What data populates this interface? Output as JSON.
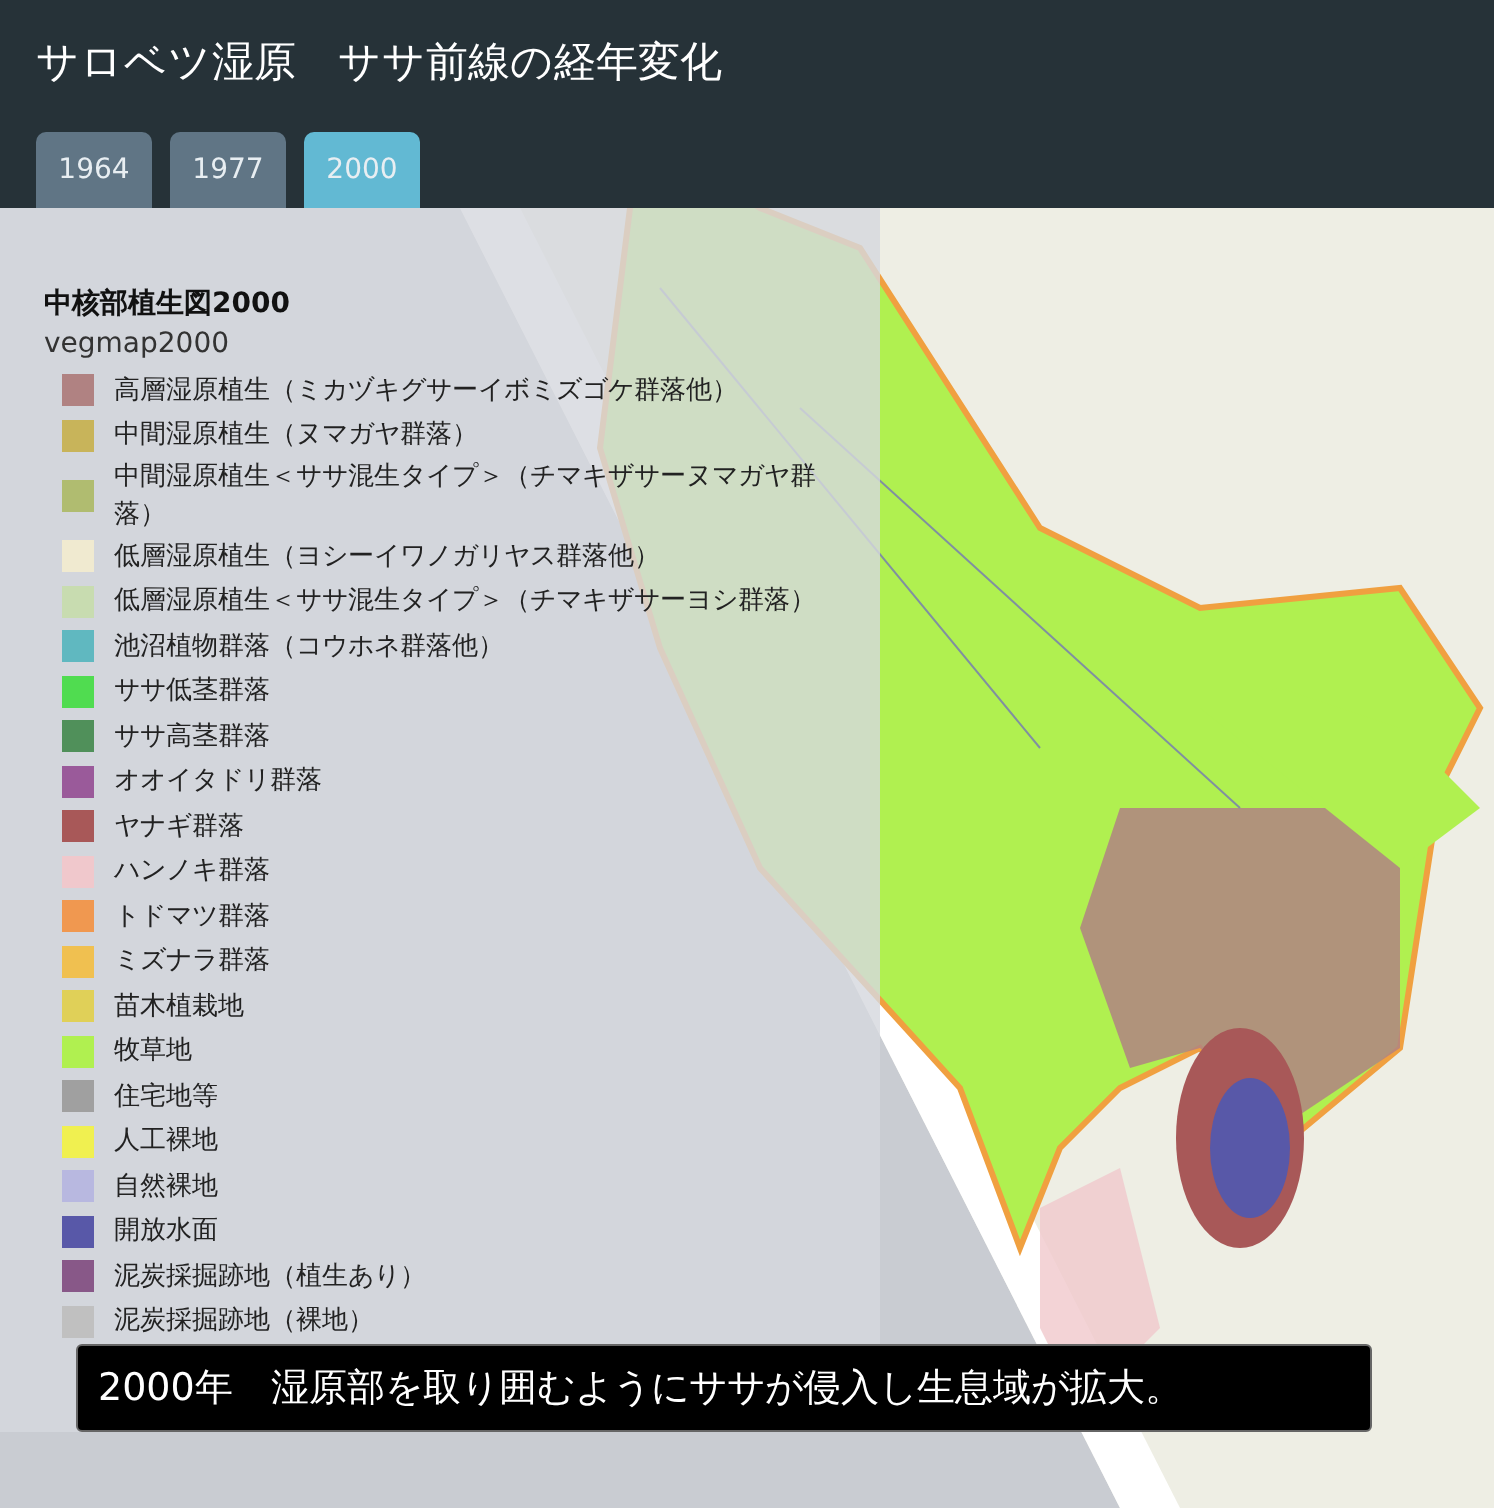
{
  "header": {
    "title": "サロベツ湿原　ササ前線の経年変化"
  },
  "tabs": [
    {
      "label": "1964",
      "selected": false
    },
    {
      "label": "1977",
      "selected": false
    },
    {
      "label": "2000",
      "selected": true
    }
  ],
  "legend": {
    "title": "中核部植生図2000",
    "layer": "vegmap2000",
    "items": [
      {
        "label": "高層湿原植生（ミカヅキグサーイボミズゴケ群落他）",
        "color": "#b08282"
      },
      {
        "label": "中間湿原植生（ヌマガヤ群落）",
        "color": "#c8b45a"
      },
      {
        "label": "中間湿原植生＜ササ混生タイプ＞（チマキザサーヌマガヤ群落）",
        "color": "#b0bc70"
      },
      {
        "label": "低層湿原植生（ヨシーイワノガリヤス群落他）",
        "color": "#f0ead0"
      },
      {
        "label": "低層湿原植生＜ササ混生タイプ＞（チマキザサーヨシ群落）",
        "color": "#c8dcb0"
      },
      {
        "label": "池沼植物群落（コウホネ群落他）",
        "color": "#60b8c0"
      },
      {
        "label": "ササ低茎群落",
        "color": "#50dc50"
      },
      {
        "label": "ササ高茎群落",
        "color": "#50905a"
      },
      {
        "label": "オオイタドリ群落",
        "color": "#9a5a9a"
      },
      {
        "label": "ヤナギ群落",
        "color": "#a85858"
      },
      {
        "label": "ハンノキ群落",
        "color": "#f0c8cc"
      },
      {
        "label": "トドマツ群落",
        "color": "#f09850"
      },
      {
        "label": "ミズナラ群落",
        "color": "#f0c050"
      },
      {
        "label": "苗木植栽地",
        "color": "#e0d058"
      },
      {
        "label": "牧草地",
        "color": "#b0f050"
      },
      {
        "label": "住宅地等",
        "color": "#a0a0a0"
      },
      {
        "label": "人工裸地",
        "color": "#f0f050"
      },
      {
        "label": "自然裸地",
        "color": "#b8b8e0"
      },
      {
        "label": "開放水面",
        "color": "#5858a8"
      },
      {
        "label": "泥炭採掘跡地（植生あり）",
        "color": "#885888"
      },
      {
        "label": "泥炭採掘跡地（裸地）",
        "color": "#c0c0c0"
      }
    ]
  },
  "caption": "2000年　湿原部を取り囲むようにササが侵入し生息域が拡大。"
}
